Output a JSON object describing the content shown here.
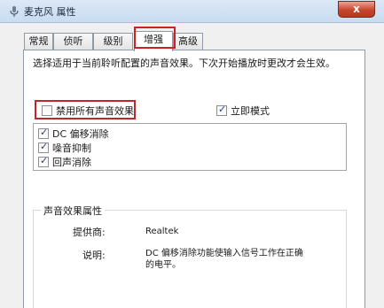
{
  "window": {
    "title": "麦克风 属性",
    "close_label": "x"
  },
  "tabs": [
    {
      "label": "常规",
      "active": false
    },
    {
      "label": "侦听",
      "active": false
    },
    {
      "label": "级别",
      "active": false
    },
    {
      "label": "增强",
      "active": true
    },
    {
      "label": "高级",
      "active": false
    }
  ],
  "enhancements": {
    "description": "选择适用于当前聆听配置的声音效果。下次开始播放时更改才会生效。",
    "disable_all_label": "禁用所有声音效果",
    "disable_all_checked": false,
    "immediate_mode_label": "立即模式",
    "immediate_mode_checked": true,
    "effects": [
      {
        "label": "DC 偏移消除",
        "checked": true
      },
      {
        "label": "噪音抑制",
        "checked": true
      },
      {
        "label": "回声消除",
        "checked": true
      }
    ]
  },
  "properties": {
    "group_title": "声音效果属性",
    "provider_label": "提供商:",
    "provider_value": "Realtek",
    "description_label": "说明:",
    "description_value": "DC 偏移消除功能使输入信号工作在正确的电平。"
  },
  "colors": {
    "highlight_border": "#d02020",
    "check_mark": "#2a3f8a"
  }
}
